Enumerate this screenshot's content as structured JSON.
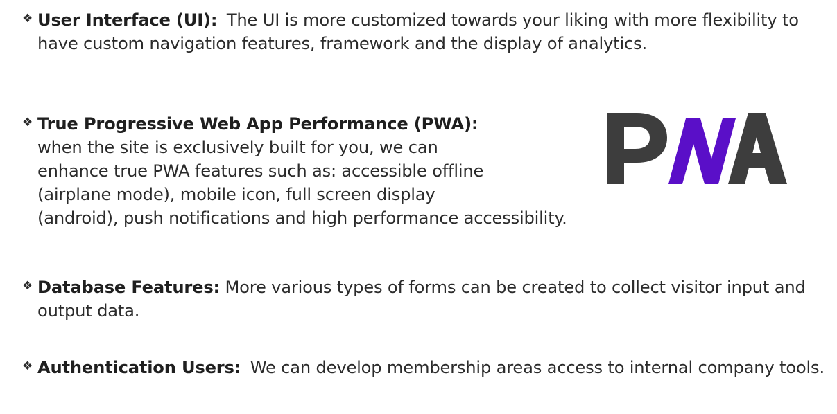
{
  "bullet_glyph": "❖",
  "items": [
    {
      "id": "ui",
      "title": "User Interface (UI):",
      "body": "The UI is more customized towards your liking with more flexibility to have custom navigation features, framework and the display of analytics."
    },
    {
      "id": "pwa",
      "title": "True Progressive Web App Performance (PWA):",
      "lines": [
        "when the site is exclusively built for you, we can",
        "enhance true PWA features such as: accessible offline",
        "(airplane mode), mobile icon, full screen display",
        "(android), push notifications and high performance accessibility."
      ]
    },
    {
      "id": "db",
      "title": "Database Features:",
      "body": "More various types of forms can be created to collect visitor input and output data."
    },
    {
      "id": "auth",
      "title": "Authentication Users:",
      "body": "We can develop membership areas access to internal company tools."
    }
  ],
  "logo": {
    "text": "PWA",
    "colors": {
      "dark": "#3d3d3d",
      "accent": "#5a0fc8"
    }
  }
}
